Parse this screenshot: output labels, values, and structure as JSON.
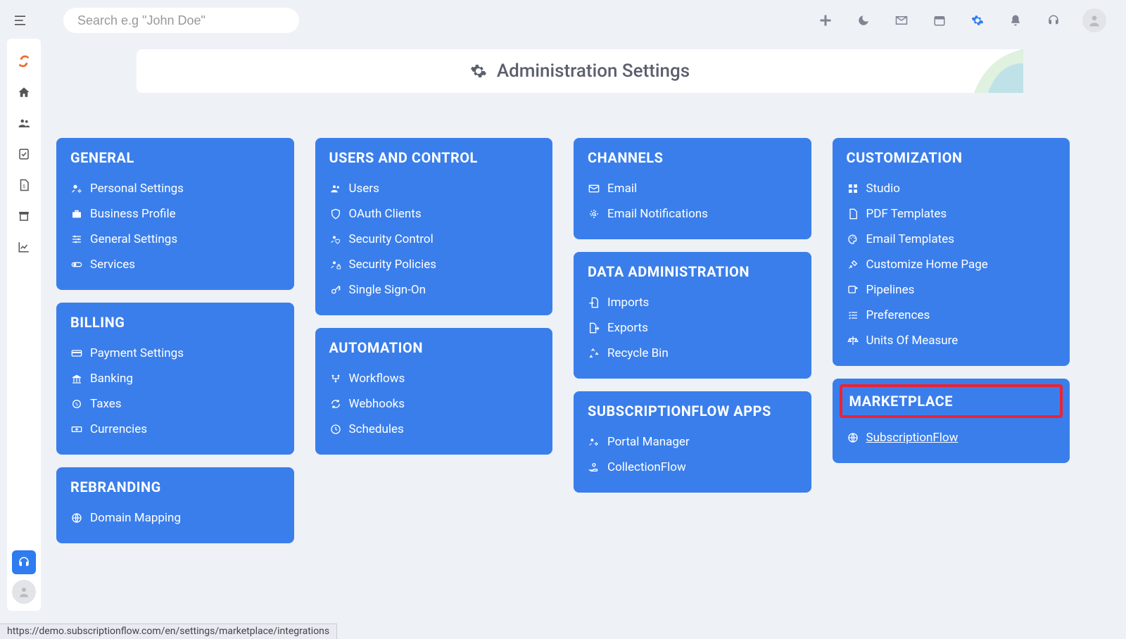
{
  "search": {
    "placeholder": "Search e.g \"John Doe\""
  },
  "page_title": "Administration Settings",
  "cards": {
    "general": {
      "title": "GENERAL",
      "links": {
        "personal": "Personal Settings",
        "business": "Business Profile",
        "general": "General Settings",
        "services": "Services"
      }
    },
    "billing": {
      "title": "BILLING",
      "links": {
        "payment": "Payment Settings",
        "banking": "Banking",
        "taxes": "Taxes",
        "currencies": "Currencies"
      }
    },
    "rebranding": {
      "title": "REBRANDING",
      "links": {
        "domain_mapping": "Domain Mapping"
      }
    },
    "users_control": {
      "title": "USERS AND CONTROL",
      "links": {
        "users": "Users",
        "oauth": "OAuth Clients",
        "security_control": "Security Control",
        "security_policies": "Security Policies",
        "sso": "Single Sign-On"
      }
    },
    "automation": {
      "title": "AUTOMATION",
      "links": {
        "workflows": "Workflows",
        "webhooks": "Webhooks",
        "schedules": "Schedules"
      }
    },
    "channels": {
      "title": "CHANNELS",
      "links": {
        "email": "Email",
        "email_notifications": "Email Notifications"
      }
    },
    "data_admin": {
      "title": "DATA ADMINISTRATION",
      "links": {
        "imports": "Imports",
        "exports": "Exports",
        "recycle": "Recycle Bin"
      }
    },
    "sf_apps": {
      "title": "SUBSCRIPTIONFLOW APPS",
      "links": {
        "portal_manager": "Portal Manager",
        "collectionflow": "CollectionFlow"
      }
    },
    "customization": {
      "title": "CUSTOMIZATION",
      "links": {
        "studio": "Studio",
        "pdf": "PDF Templates",
        "email_templates": "Email Templates",
        "custom_home": "Customize Home Page",
        "pipelines": "Pipelines",
        "preferences": "Preferences",
        "uom": "Units Of Measure"
      }
    },
    "marketplace": {
      "title": "MARKETPLACE",
      "links": {
        "subscriptionflow": " SubscriptionFlow"
      }
    }
  },
  "status_url": "https://demo.subscriptionflow.com/en/settings/marketplace/integrations"
}
